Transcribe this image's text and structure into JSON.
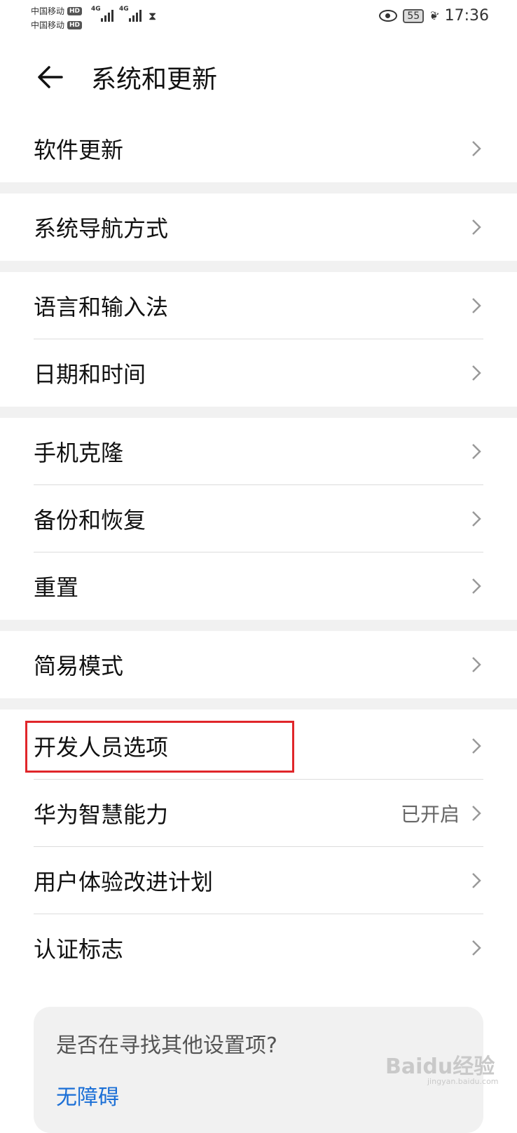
{
  "status_bar": {
    "carrier1": "中国移动",
    "carrier2": "中国移动",
    "hd": "HD",
    "network": "4G",
    "battery": "55",
    "time": "17:36"
  },
  "header": {
    "title": "系统和更新"
  },
  "sections": [
    {
      "items": [
        {
          "label": "软件更新"
        }
      ]
    },
    {
      "items": [
        {
          "label": "系统导航方式"
        }
      ]
    },
    {
      "items": [
        {
          "label": "语言和输入法"
        },
        {
          "label": "日期和时间"
        }
      ]
    },
    {
      "items": [
        {
          "label": "手机克隆"
        },
        {
          "label": "备份和恢复"
        },
        {
          "label": "重置"
        }
      ]
    },
    {
      "items": [
        {
          "label": "简易模式"
        }
      ]
    },
    {
      "items": [
        {
          "label": "开发人员选项"
        },
        {
          "label": "华为智慧能力",
          "value": "已开启"
        },
        {
          "label": "用户体验改进计划"
        },
        {
          "label": "认证标志"
        }
      ]
    }
  ],
  "suggestion_card": {
    "question": "是否在寻找其他设置项?",
    "link": "无障碍"
  },
  "watermark": {
    "text": "Baidu经验",
    "sub": "jingyan.baidu.com"
  },
  "colors": {
    "highlight": "#e0262a",
    "link": "#1b6fd6",
    "section_gap": "#f1f1f1"
  }
}
